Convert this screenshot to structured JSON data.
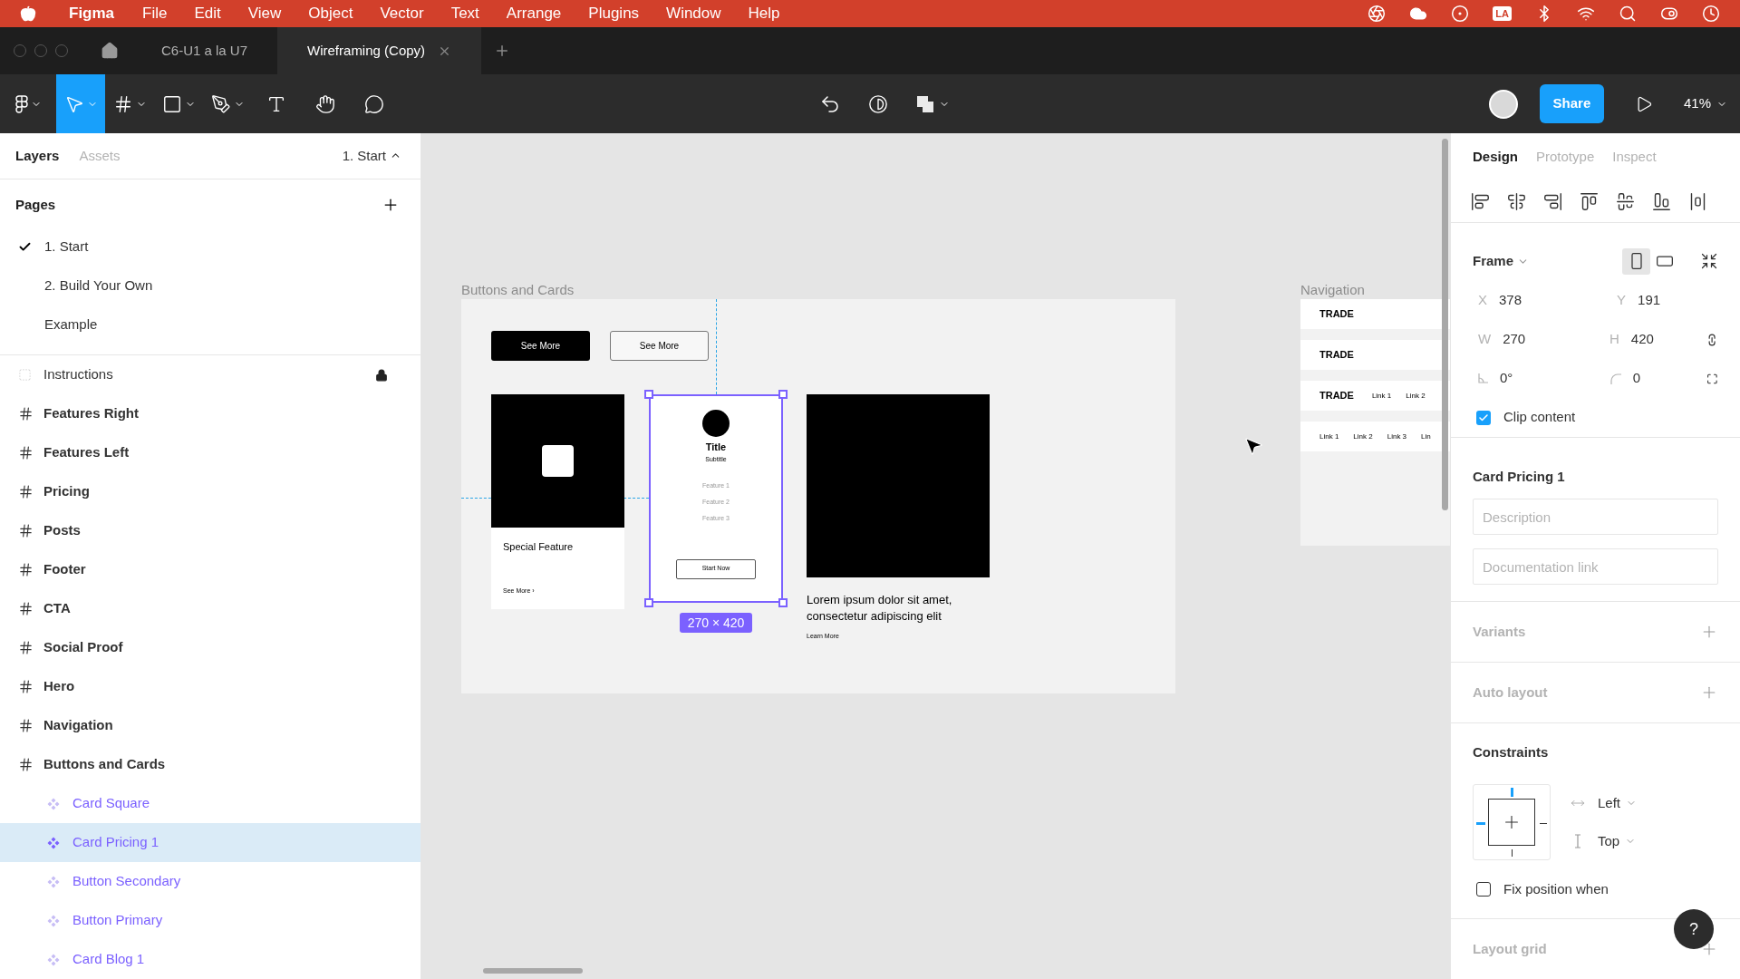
{
  "menu_bar": {
    "app": "Figma",
    "items": [
      "File",
      "Edit",
      "View",
      "Object",
      "Vector",
      "Text",
      "Arrange",
      "Plugins",
      "Window",
      "Help"
    ],
    "badge": "LA"
  },
  "tabs": [
    {
      "label": "C6-U1 a la U7",
      "selected": false
    },
    {
      "label": "Wireframing (Copy)",
      "selected": true
    }
  ],
  "toolbar": {
    "tools": [
      {
        "kind": "main",
        "selected": false
      },
      {
        "kind": "move",
        "selected": true
      },
      {
        "kind": "frame",
        "selected": false
      },
      {
        "kind": "shape",
        "selected": false
      },
      {
        "kind": "pen",
        "selected": false
      },
      {
        "kind": "text",
        "selected": false
      },
      {
        "kind": "hand",
        "selected": false
      },
      {
        "kind": "comment",
        "selected": false
      }
    ],
    "share": "Share",
    "zoom": "41%"
  },
  "left_panel": {
    "tabs": [
      {
        "label": "Layers",
        "selected": true
      },
      {
        "label": "Assets",
        "selected": false
      }
    ],
    "page_menu": "1. Start",
    "pages_title": "Pages",
    "pages": [
      {
        "label": "1. Start",
        "selected": true
      },
      {
        "label": "2. Build Your Own",
        "selected": false
      },
      {
        "label": "Example",
        "selected": false
      }
    ],
    "layers": [
      {
        "name": "Instructions",
        "kind": "section",
        "locked": true,
        "selected": false
      },
      {
        "name": "Features Right",
        "kind": "frame",
        "locked": false,
        "selected": false
      },
      {
        "name": "Features Left",
        "kind": "frame",
        "locked": false,
        "selected": false
      },
      {
        "name": "Pricing",
        "kind": "frame",
        "locked": false,
        "selected": false
      },
      {
        "name": "Posts",
        "kind": "frame",
        "locked": false,
        "selected": false
      },
      {
        "name": "Footer",
        "kind": "frame",
        "locked": false,
        "selected": false
      },
      {
        "name": "CTA",
        "kind": "frame",
        "locked": false,
        "selected": false
      },
      {
        "name": "Social Proof",
        "kind": "frame",
        "locked": false,
        "selected": false
      },
      {
        "name": "Hero",
        "kind": "frame",
        "locked": false,
        "selected": false
      },
      {
        "name": "Navigation",
        "kind": "frame",
        "locked": false,
        "selected": false
      },
      {
        "name": "Buttons and Cards",
        "kind": "frame",
        "locked": false,
        "selected": false,
        "children": [
          {
            "name": "Card Square",
            "kind": "component",
            "locked": false,
            "selected": false
          },
          {
            "name": "Card Pricing 1",
            "kind": "component",
            "locked": false,
            "selected": true
          },
          {
            "name": "Button Secondary",
            "kind": "component",
            "locked": false,
            "selected": false
          },
          {
            "name": "Button Primary",
            "kind": "component",
            "locked": false,
            "selected": false
          },
          {
            "name": "Card Blog 1",
            "kind": "component",
            "locked": false,
            "selected": false
          }
        ]
      }
    ]
  },
  "canvas": {
    "buttons_and_cards": {
      "label": "Buttons and Cards",
      "buttons": [
        {
          "label": "See More",
          "kind": "primary"
        },
        {
          "label": "See More",
          "kind": "secondary"
        }
      ],
      "card_square": {
        "title": "Special Feature",
        "link": "See More ›"
      },
      "card_pricing": {
        "title": "Title",
        "subtitle": "Subtitle",
        "features": [
          "Feature 1",
          "Feature 2",
          "Feature 3"
        ],
        "button": "Start Now",
        "selected": true,
        "size": "270 × 420"
      },
      "card_blog": {
        "text": "Lorem ipsum dolor sit amet, consectetur adipiscing elit",
        "link": "Learn More"
      }
    },
    "navigation": {
      "label": "Navigation",
      "rows": [
        {
          "brand": "TRADE",
          "links": []
        },
        {
          "brand": "TRADE",
          "links": []
        },
        {
          "brand": "TRADE",
          "links": [
            "Link 1",
            "Link 2"
          ]
        },
        {
          "links": [
            "Link 1",
            "Link 2",
            "Link 3",
            "Lin"
          ]
        }
      ]
    }
  },
  "right_panel": {
    "tabs": [
      {
        "label": "Design",
        "selected": true
      },
      {
        "label": "Prototype",
        "selected": false
      },
      {
        "label": "Inspect",
        "selected": false
      }
    ],
    "frame": {
      "title": "Frame",
      "orientations": [
        {
          "kind": "portrait",
          "selected": true
        },
        {
          "kind": "landscape",
          "selected": false
        }
      ],
      "fields": [
        {
          "label": "X",
          "value": "378"
        },
        {
          "label": "Y",
          "value": "191"
        },
        {
          "label": "W",
          "value": "270"
        },
        {
          "label": "H",
          "value": "420"
        }
      ],
      "rotation": "0°",
      "radius": "0",
      "clip": {
        "label": "Clip content",
        "checked": true
      }
    },
    "component": {
      "name": "Card Pricing 1",
      "description_placeholder": "Description",
      "link_placeholder": "Documentation link"
    },
    "sections_top": [
      {
        "title": "Variants",
        "active": false
      },
      {
        "title": "Auto layout",
        "active": false
      }
    ],
    "constraints": {
      "title": "Constraints",
      "horizontal": "Left",
      "vertical": "Top",
      "fix": {
        "label": "Fix position when",
        "checked": false
      }
    },
    "sections_bottom": [
      {
        "title": "Layout grid",
        "active": false
      }
    ],
    "help": "?"
  }
}
